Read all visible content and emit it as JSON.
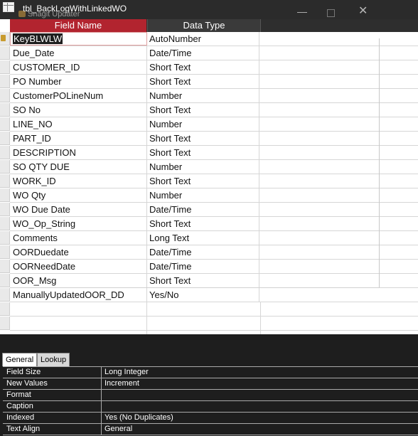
{
  "window": {
    "title": "tbl_BackLogWithLinkedWO",
    "overlay_title": "Snagit Updater",
    "controls": {
      "minimize": "—",
      "close": "✕"
    }
  },
  "grid": {
    "headers": {
      "field_name": "Field Name",
      "data_type": "Data Type",
      "description": ""
    },
    "rows": [
      {
        "name": "KeyBLWLW",
        "type": "AutoNumber"
      },
      {
        "name": "Due_Date",
        "type": "Date/Time"
      },
      {
        "name": "CUSTOMER_ID",
        "type": "Short Text"
      },
      {
        "name": "PO Number",
        "type": "Short Text"
      },
      {
        "name": "CustomerPOLineNum",
        "type": "Number"
      },
      {
        "name": "SO No",
        "type": "Short Text"
      },
      {
        "name": "LINE_NO",
        "type": "Number"
      },
      {
        "name": "PART_ID",
        "type": "Short Text"
      },
      {
        "name": "DESCRIPTION",
        "type": "Short Text"
      },
      {
        "name": "SO QTY DUE",
        "type": "Number"
      },
      {
        "name": "WORK_ID",
        "type": "Short Text"
      },
      {
        "name": "WO Qty",
        "type": "Number"
      },
      {
        "name": "WO Due Date",
        "type": "Date/Time"
      },
      {
        "name": "WO_Op_String",
        "type": "Short Text"
      },
      {
        "name": "Comments",
        "type": "Long Text"
      },
      {
        "name": "OORDuedate",
        "type": "Date/Time"
      },
      {
        "name": "OORNeedDate",
        "type": "Date/Time"
      },
      {
        "name": "OOR_Msg",
        "type": "Short Text"
      },
      {
        "name": "ManuallyUpdatedOOR_DD",
        "type": "Yes/No"
      }
    ]
  },
  "properties": {
    "tabs": {
      "general": "General",
      "lookup": "Lookup"
    },
    "items": [
      {
        "label": "Field Size",
        "value": "Long Integer"
      },
      {
        "label": "New Values",
        "value": "Increment"
      },
      {
        "label": "Format",
        "value": ""
      },
      {
        "label": "Caption",
        "value": ""
      },
      {
        "label": "Indexed",
        "value": "Yes (No Duplicates)"
      },
      {
        "label": "Text Align",
        "value": "General"
      }
    ]
  }
}
